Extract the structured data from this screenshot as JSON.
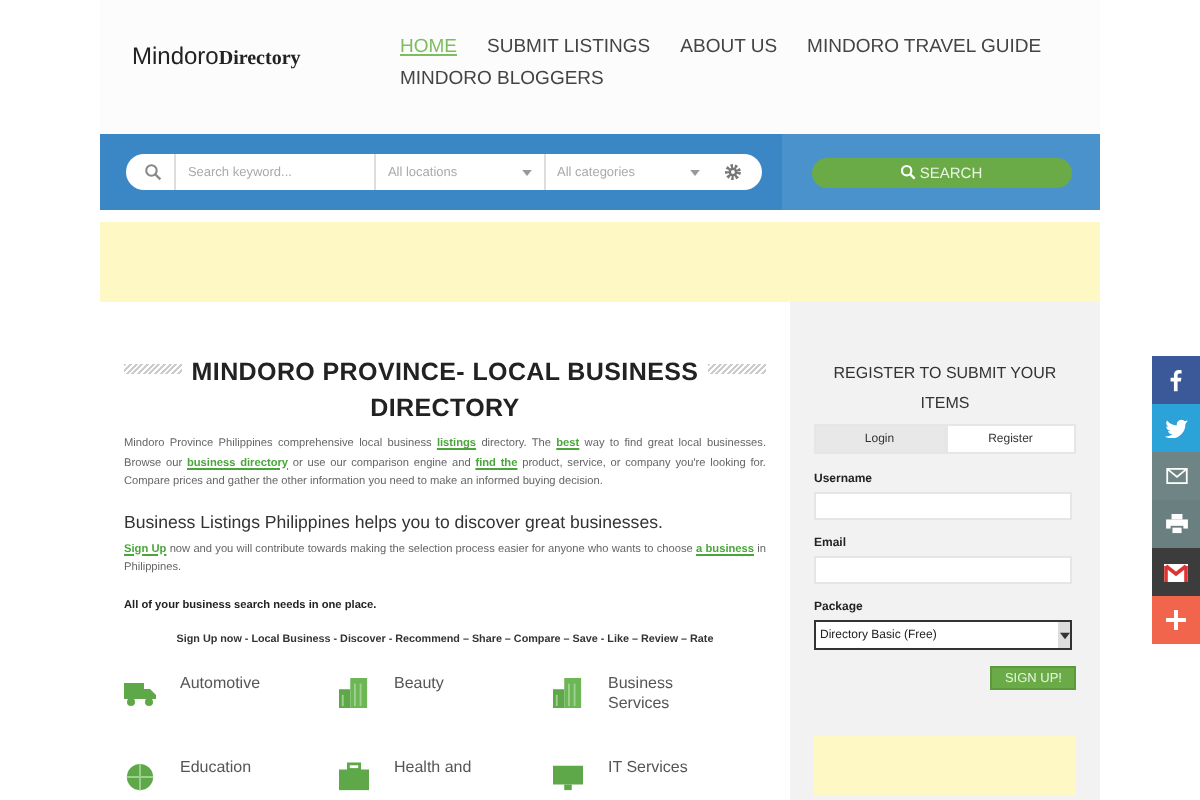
{
  "header": {
    "logo_main": "Mindoro",
    "logo_accent": "Directory",
    "nav": [
      {
        "label": "HOME",
        "selected": true
      },
      {
        "label": "SUBMIT LISTINGS",
        "selected": false
      },
      {
        "label": "ABOUT US",
        "selected": false
      },
      {
        "label": "MINDORO TRAVEL GUIDE",
        "selected": false
      },
      {
        "label": "MINDORO BLOGGERS",
        "selected": false
      }
    ]
  },
  "search": {
    "keyword_placeholder": "Search keyword...",
    "location_placeholder": "All locations",
    "category_placeholder": "All categories",
    "button": "SEARCH"
  },
  "main": {
    "title": "MINDORO PROVINCE- LOCAL BUSINESS DIRECTORY",
    "intro": [
      {
        "text": "Mindoro Province Philippines comprehensive local business "
      },
      {
        "text": "listings",
        "link": true
      },
      {
        "text": " directory. The "
      },
      {
        "text": "best",
        "link": true
      },
      {
        "text": " way to find great local businesses. Browse our "
      },
      {
        "text": "business directory",
        "link": true
      },
      {
        "text": " or use our comparison engine and "
      },
      {
        "text": "find the",
        "link": true
      },
      {
        "text": " product, service, or company you're looking for. Compare prices and gather the other information you need to make an informed buying decision."
      }
    ],
    "subheading": "Business Listings Philippines helps you to discover great businesses.",
    "signup_paragraph": [
      {
        "text": "Sign Up",
        "link": true
      },
      {
        "text": " now and you will contribute towards making the selection process easier for anyone who wants to choose "
      },
      {
        "text": "a business",
        "link": true
      },
      {
        "text": " in Philippines."
      }
    ],
    "bold_line": "All of your business search needs in one place.",
    "tagline": "Sign Up now - Local Business - Discover - Recommend – Share – Compare – Save - Like – Review – Rate",
    "categories": [
      {
        "label": "Automotive",
        "kind": "truck"
      },
      {
        "label": "Beauty",
        "kind": "building"
      },
      {
        "label": "Business Services",
        "kind": "building"
      },
      {
        "label": "Education",
        "kind": "globe"
      },
      {
        "label": "Health and",
        "kind": "briefcase"
      },
      {
        "label": "IT Services",
        "kind": "monitor"
      }
    ]
  },
  "sidebar": {
    "title": "REGISTER TO SUBMIT YOUR ITEMS",
    "tabs": [
      {
        "label": "Login",
        "selected": false
      },
      {
        "label": "Register",
        "selected": true
      }
    ],
    "username_label": "Username",
    "email_label": "Email",
    "package_label": "Package",
    "package_value": "Directory Basic (Free)",
    "signup_button": "SIGN UP!"
  },
  "share": [
    {
      "kind": "facebook",
      "color": "#3b5998"
    },
    {
      "kind": "twitter",
      "color": "#2ba3d8"
    },
    {
      "kind": "email",
      "color": "#6f8585"
    },
    {
      "kind": "print",
      "color": "#6a8080"
    },
    {
      "kind": "gmail",
      "color": "#3c3c3c"
    },
    {
      "kind": "plus",
      "color": "#f0654b"
    }
  ]
}
